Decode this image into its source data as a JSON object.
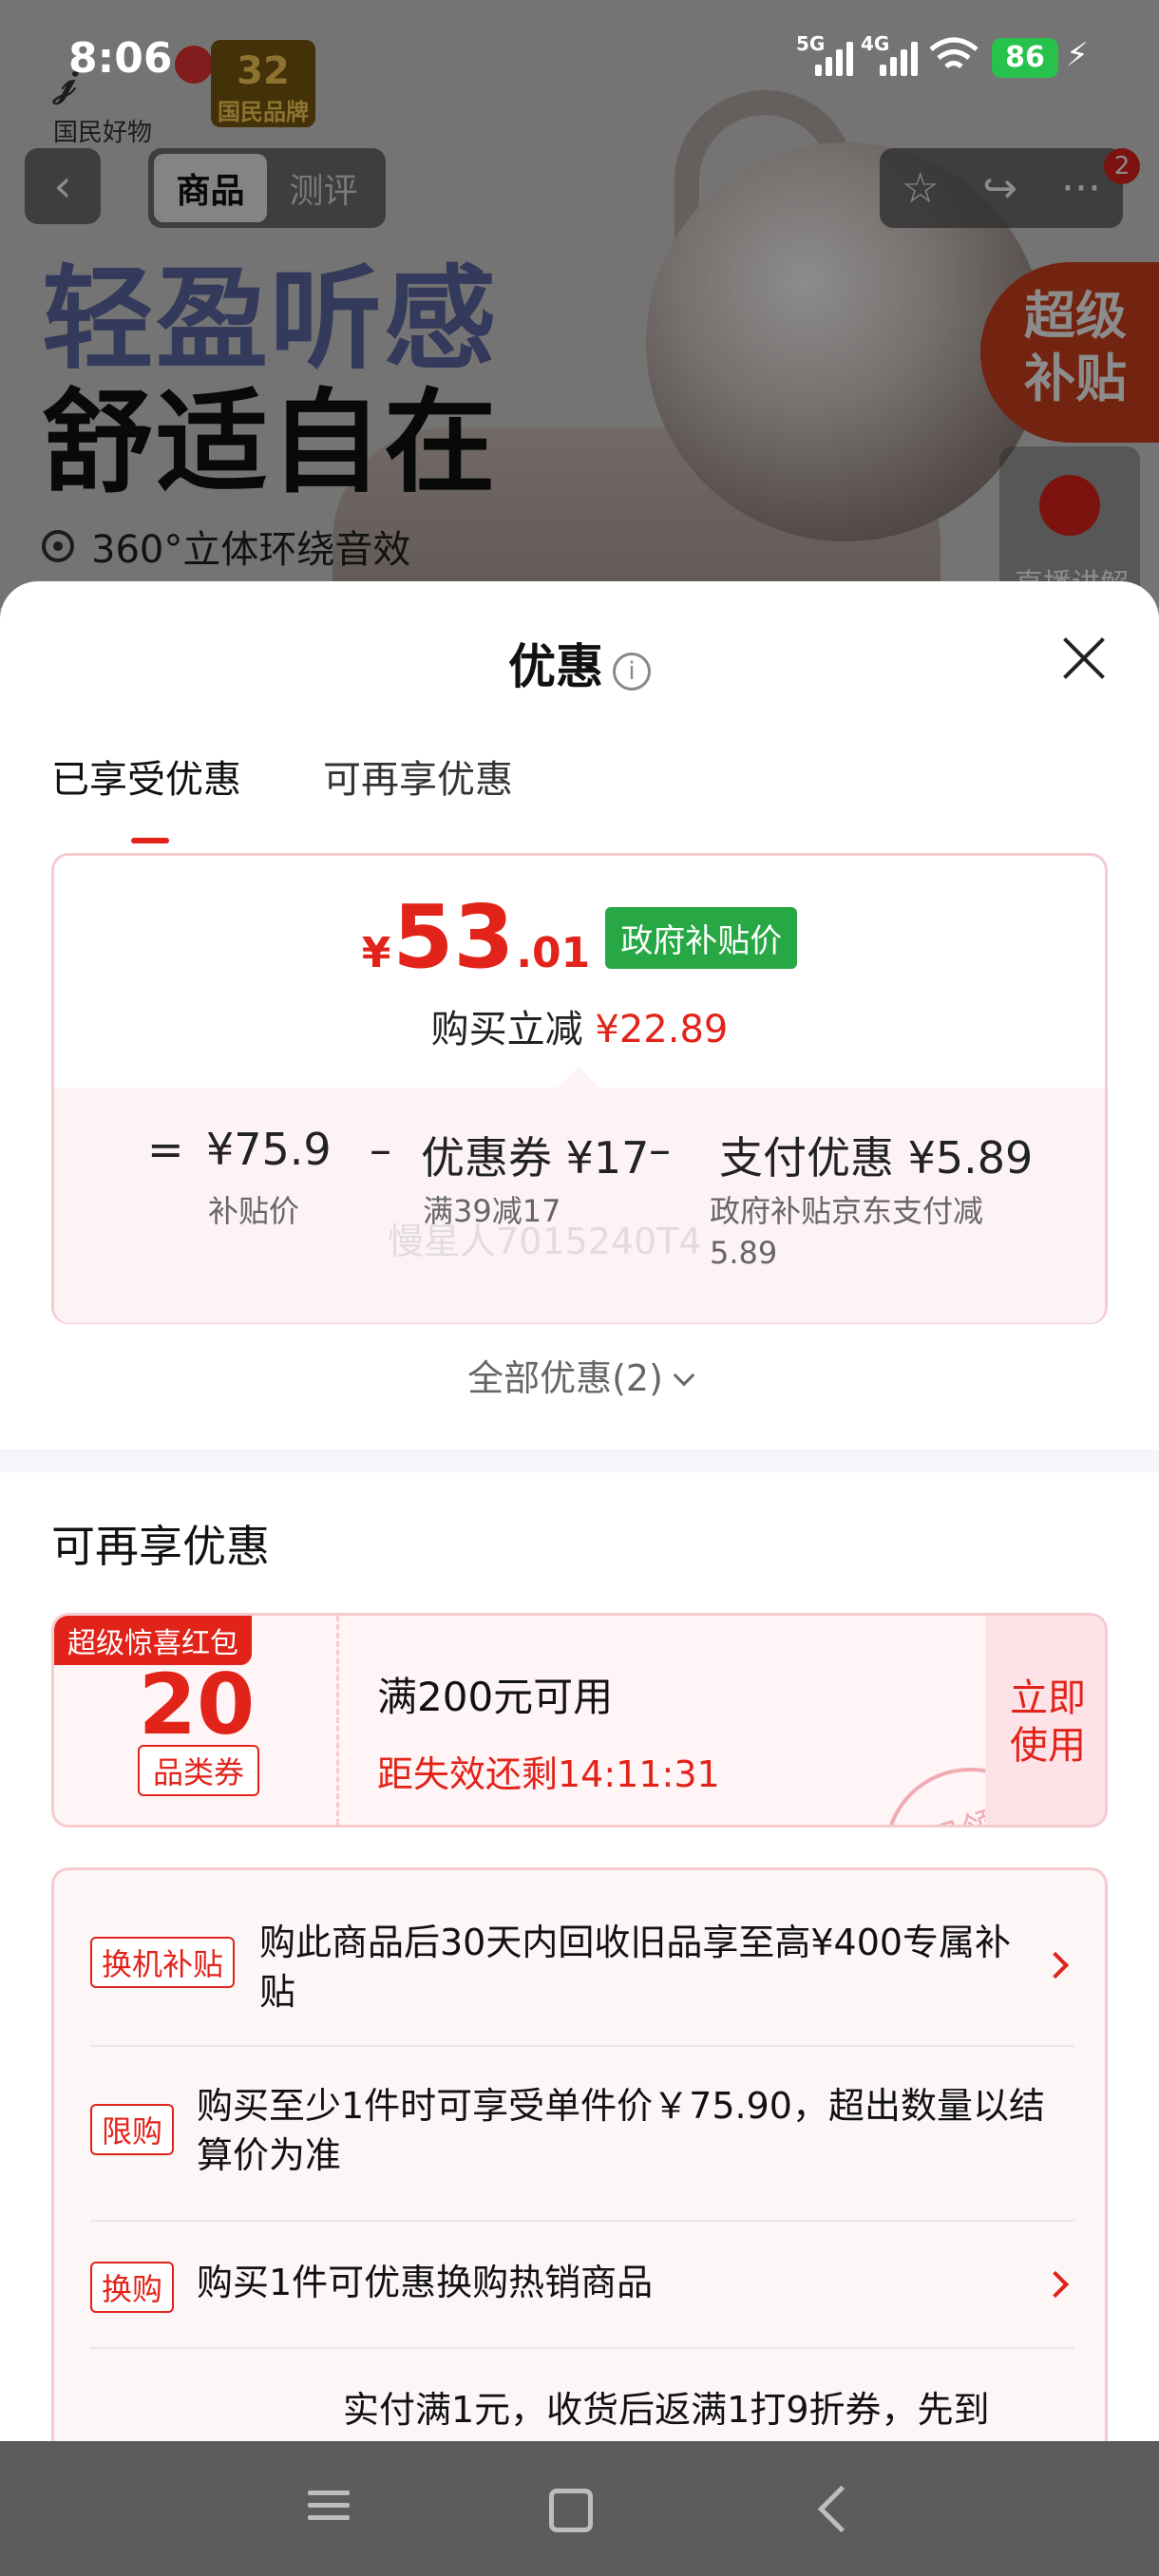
{
  "status_bar": {
    "time": "8:06",
    "dots": "···",
    "net1": "5G",
    "net2": "4G",
    "battery": "86"
  },
  "background": {
    "brand": "国民好物",
    "badge_num": "32",
    "badge_text": "国民品牌",
    "headline1": "轻盈听感",
    "headline2": "舒适自在",
    "feature": "360°立体环绕音效",
    "nav_tabs": [
      "商品",
      "测评"
    ],
    "cart_badge": "2",
    "super_subsidy": [
      "超级",
      "补贴"
    ],
    "live_label": "直播讲解"
  },
  "sheet": {
    "title": "优惠",
    "tabs": [
      "已享受优惠",
      "可再享优惠"
    ],
    "price": {
      "symbol": "¥",
      "integer": "53",
      "decimal": ".01",
      "tag": "政府补贴价"
    },
    "saved_label": "购买立减",
    "saved_amount": "¥22.89",
    "calc": {
      "eq": "=",
      "minus": "–",
      "base_price": "¥75.9",
      "base_label": "补贴价",
      "coupon": "优惠券 ¥17",
      "coupon_label": "满39减17",
      "pay": "支付优惠 ¥5.89",
      "pay_label": "政府补贴京东支付减5.89"
    },
    "all_promos": "全部优惠(2)",
    "section_title": "可再享优惠",
    "coupon": {
      "ribbon": "超级惊喜红包",
      "value": "20",
      "type": "品类券",
      "condition": "满200元可用",
      "timer": "距失效还剩14:11:31",
      "use": "立即使用",
      "stamp": "已领"
    },
    "promos": [
      {
        "tag": "换机补贴",
        "text": "购此商品后30天内回收旧品享至高¥400专属补贴"
      },
      {
        "tag": "限购",
        "text": "购买至少1件时可享受单件价￥75.90，超出数量以结算价为准"
      },
      {
        "tag": "换购",
        "text": "购买1件可优惠换购热销商品"
      },
      {
        "tag": "",
        "text": "实付满1元，收货后返满1打9折券，先到"
      }
    ],
    "watermark": "慢星人7015240T4"
  },
  "colors": {
    "accent": "#e2231a",
    "gov_green": "#27a844",
    "card_border": "#f5cbd0"
  }
}
